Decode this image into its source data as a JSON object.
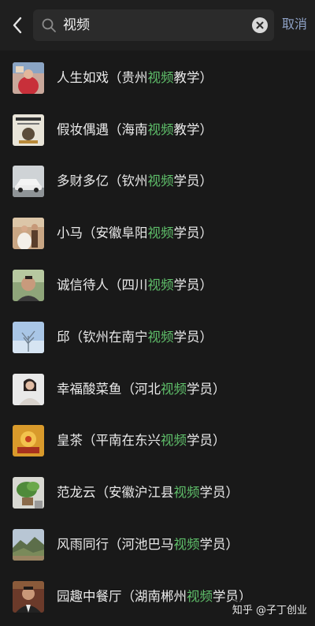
{
  "search": {
    "query": "视频",
    "cancel_label": "取消"
  },
  "highlight_color": "#5fbf6a",
  "results": [
    {
      "pre": "人生如戏（贵州",
      "hl": "视频",
      "post": "教学）",
      "avatar": "red-figure"
    },
    {
      "pre": "假妆偶遇（海南",
      "hl": "视频",
      "post": "教学）",
      "avatar": "poster"
    },
    {
      "pre": "多财多亿（钦州",
      "hl": "视频",
      "post": "学员）",
      "avatar": "white-car"
    },
    {
      "pre": "小马（安徽阜阳",
      "hl": "视频",
      "post": "学员）",
      "avatar": "wedding"
    },
    {
      "pre": "诚信待人（四川",
      "hl": "视频",
      "post": "学员）",
      "avatar": "man-portrait"
    },
    {
      "pre": "邱（钦州在南宁",
      "hl": "视频",
      "post": "学员）",
      "avatar": "tree-sky"
    },
    {
      "pre": "幸福酸菜鱼（河北",
      "hl": "视频",
      "post": "学员）",
      "avatar": "woman-white"
    },
    {
      "pre": "皇茶（平南在东兴",
      "hl": "视频",
      "post": "学员）",
      "avatar": "golden"
    },
    {
      "pre": "范龙云（安徽沪江县",
      "hl": "视频",
      "post": "学员）",
      "avatar": "plant"
    },
    {
      "pre": "风雨同行（河池巴马",
      "hl": "视频",
      "post": "学员）",
      "avatar": "landscape"
    },
    {
      "pre": "园趣中餐厅（湖南郴州",
      "hl": "视频",
      "post": "学员）",
      "avatar": "man-suit"
    }
  ],
  "watermark": {
    "text": "知乎 @子丁创业"
  }
}
